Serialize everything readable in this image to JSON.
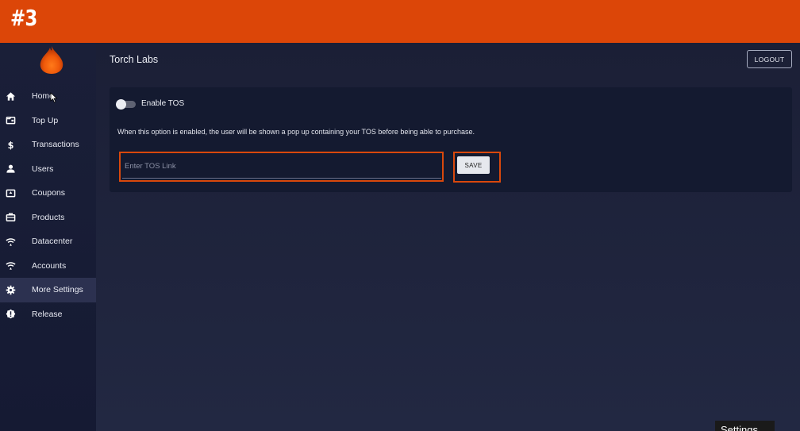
{
  "banner": {
    "text": "#3"
  },
  "colors": {
    "banner": "#dc4608",
    "highlight": "#d9480c",
    "active_nav": "#2c3150"
  },
  "sidebar": {
    "logo": "flame-logo",
    "items": [
      {
        "label": "Home",
        "icon": "home-icon"
      },
      {
        "label": "Top Up",
        "icon": "wallet-icon"
      },
      {
        "label": "Transactions",
        "icon": "dollar-icon"
      },
      {
        "label": "Users",
        "icon": "user-icon"
      },
      {
        "label": "Coupons",
        "icon": "coupon-icon"
      },
      {
        "label": "Products",
        "icon": "briefcase-icon"
      },
      {
        "label": "Datacenter",
        "icon": "wifi-icon"
      },
      {
        "label": "Accounts",
        "icon": "wifi-icon"
      },
      {
        "label": "More Settings",
        "icon": "gear-icon",
        "active": true
      },
      {
        "label": "Release",
        "icon": "alert-icon"
      }
    ]
  },
  "header": {
    "title": "Torch Labs",
    "logout_label": "LOGOUT"
  },
  "tos_card": {
    "toggle_label": "Enable TOS",
    "toggle_on": false,
    "help_text": "When this option is enabled, the user will be shown a pop up containing your TOS before being able to purchase.",
    "input_placeholder": "Enter TOS Link",
    "input_value": "",
    "save_label": "SAVE"
  },
  "tooltip": {
    "text": "Settings"
  }
}
